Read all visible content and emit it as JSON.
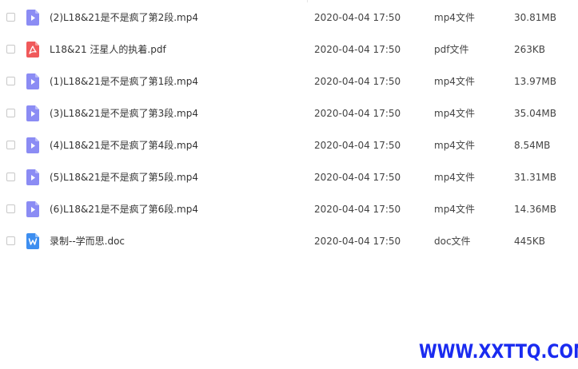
{
  "files": [
    {
      "icon": "video-file-icon",
      "name": "(2)L18&21是不是疯了第2段.mp4",
      "date": "2020-04-04 17:50",
      "type": "mp4文件",
      "size": "30.81MB"
    },
    {
      "icon": "pdf-file-icon",
      "name": "L18&21 汪星人的执着.pdf",
      "date": "2020-04-04 17:50",
      "type": "pdf文件",
      "size": "263KB"
    },
    {
      "icon": "video-file-icon",
      "name": "(1)L18&21是不是疯了第1段.mp4",
      "date": "2020-04-04 17:50",
      "type": "mp4文件",
      "size": "13.97MB"
    },
    {
      "icon": "video-file-icon",
      "name": "(3)L18&21是不是疯了第3段.mp4",
      "date": "2020-04-04 17:50",
      "type": "mp4文件",
      "size": "35.04MB"
    },
    {
      "icon": "video-file-icon",
      "name": "(4)L18&21是不是疯了第4段.mp4",
      "date": "2020-04-04 17:50",
      "type": "mp4文件",
      "size": "8.54MB"
    },
    {
      "icon": "video-file-icon",
      "name": "(5)L18&21是不是疯了第5段.mp4",
      "date": "2020-04-04 17:50",
      "type": "mp4文件",
      "size": "31.31MB"
    },
    {
      "icon": "video-file-icon",
      "name": "(6)L18&21是不是疯了第6段.mp4",
      "date": "2020-04-04 17:50",
      "type": "mp4文件",
      "size": "14.36MB"
    },
    {
      "icon": "word-file-icon",
      "name": "录制--学而思.doc",
      "date": "2020-04-04 17:50",
      "type": "doc文件",
      "size": "445KB"
    }
  ],
  "colors": {
    "video_icon": "#8b8cf4",
    "pdf_icon": "#f0595a",
    "word_icon": "#3d8ef0",
    "watermark": "#1a2bf0"
  },
  "watermark": "WWW.XXTTQ.COM"
}
